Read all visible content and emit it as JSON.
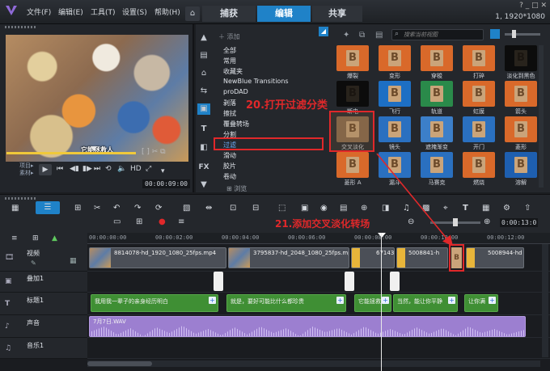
{
  "menu": [
    "文件(F)",
    "编辑(E)",
    "工具(T)",
    "设置(S)",
    "帮助(H)"
  ],
  "tabs": {
    "home": "⌂",
    "capture": "捕获",
    "edit": "编辑",
    "share": "共享"
  },
  "window": {
    "controls": "? _ □ ✕",
    "resolution": "1, 1920*1080"
  },
  "preview": {
    "subtitle": "它能拯救人",
    "mode_label_1": "项目▸",
    "mode_label_2": "素材▸",
    "timecode": "00:00:09:00",
    "hd_label": "HD"
  },
  "library": {
    "add_label": "添加",
    "search_placeholder": "搜索当前视图",
    "browse_label": "浏览",
    "categories": [
      "全部",
      "常用",
      "收藏夹",
      "NewBlue Transitions",
      "proDAD",
      "剥落",
      "擦拭",
      "覆叠转场",
      "分割",
      "过滤",
      "滑动",
      "胶片",
      "卷动"
    ],
    "selected_category": "过滤",
    "thumbnails": [
      [
        "爆裂",
        "变形",
        "穿梭",
        "打碎",
        "淡化到黑色"
      ],
      [
        "断电",
        "飞行",
        "轨道",
        "虹膜",
        "箭头"
      ],
      [
        "交叉淡化",
        "镜头",
        "遮掩渐变",
        "开门",
        "菱形"
      ],
      [
        "菱形 A",
        "漏斗",
        "马赛克",
        "燃烧",
        "溶解"
      ]
    ],
    "thumb_colors": [
      [
        "#d9692a",
        "#d9692a",
        "#d9692a",
        "#d9692a",
        "#0c0c0c"
      ],
      [
        "#0c0c0c",
        "#1d6fc4",
        "#2a8a4a",
        "#d9692a",
        "#d9692a"
      ],
      [
        "#8a6a4c",
        "#2a70c0",
        "#3c7fc9",
        "#2a70c0",
        "#d9692a"
      ],
      [
        "#d9692a",
        "#2a70c0",
        "#2a70c0",
        "#d9692a",
        "#1e5fb0"
      ]
    ]
  },
  "annotations": {
    "step20": "20.打开过滤分类",
    "step21": "21.添加交叉淡化转场"
  },
  "timeline": {
    "timecode": "0:00:13:0",
    "ruler": [
      "00:00:00:00",
      "00:00:02:00",
      "00:00:04:00",
      "00:00:06:00",
      "00:00:08:00",
      "00:00:10:00",
      "00:00:12:00"
    ],
    "tracks": [
      {
        "name": "视频",
        "icon": "🎞"
      },
      {
        "name": "叠加1",
        "icon": "▣"
      },
      {
        "name": "标题1",
        "icon": "T"
      },
      {
        "name": "声音",
        "icon": "♪"
      },
      {
        "name": "音乐1",
        "icon": "♫"
      }
    ],
    "video_clips": [
      "8814078-hd_1920_1080_25fps.mp4",
      "3795837-hd_2048_1080_25fps.mp4",
      "67143",
      "5008841-h",
      "5008944-hd"
    ],
    "title_clips": [
      "我用我一辈子的亲身经历明白",
      "就是，要好可能比什么都珍贵",
      "它能拯救",
      "当然，能让你平静",
      "让你满"
    ],
    "audio_clip": "7月7日.WAV"
  }
}
